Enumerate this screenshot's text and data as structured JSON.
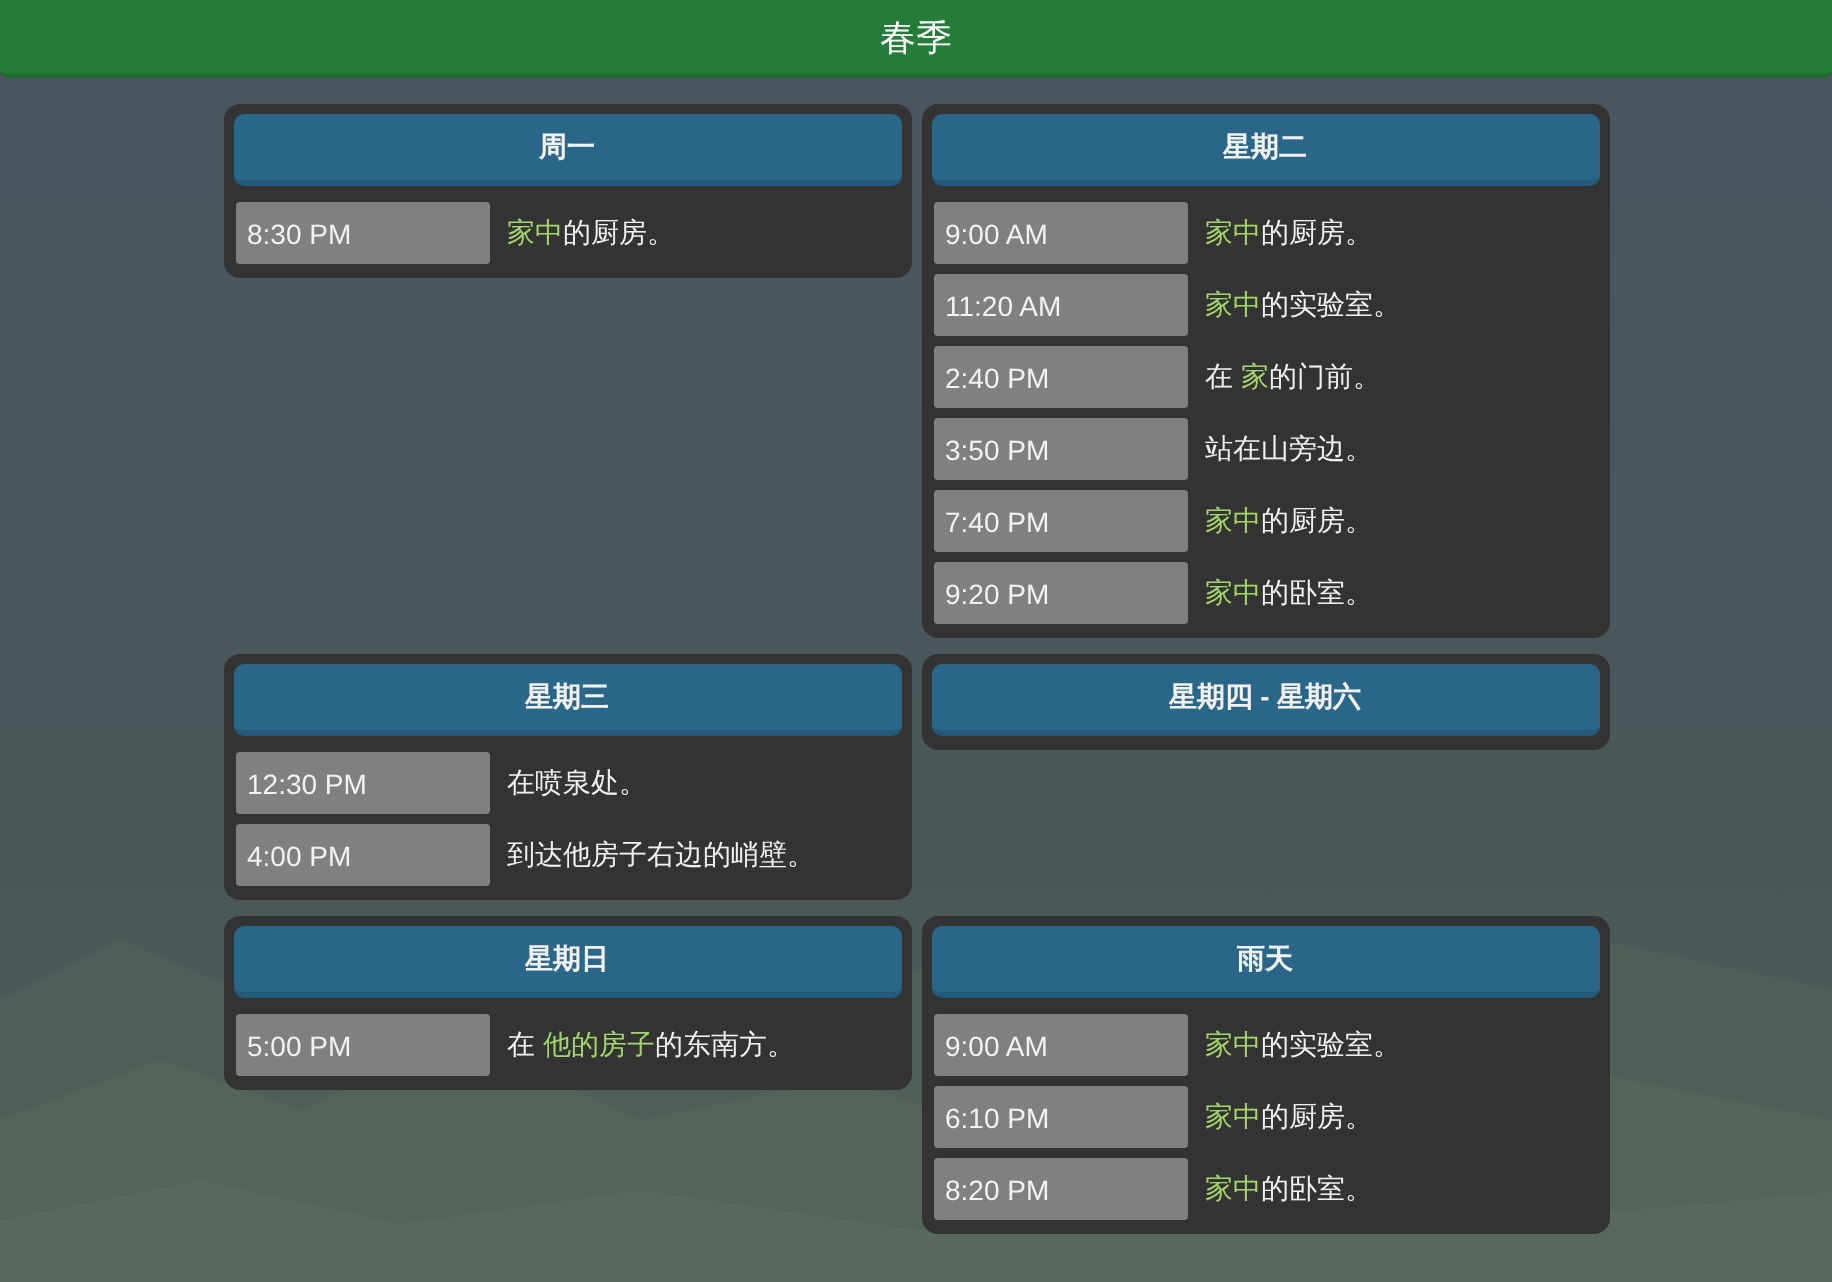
{
  "title": "春季",
  "days": [
    {
      "name": "周一",
      "entries": [
        {
          "time": "8:30 PM",
          "place": [
            {
              "text": "家中",
              "highlight": true
            },
            {
              "text": "的厨房。",
              "highlight": false
            }
          ]
        }
      ]
    },
    {
      "name": "星期二",
      "entries": [
        {
          "time": "9:00 AM",
          "place": [
            {
              "text": "家中",
              "highlight": true
            },
            {
              "text": "的厨房。",
              "highlight": false
            }
          ]
        },
        {
          "time": "11:20 AM",
          "place": [
            {
              "text": "家中",
              "highlight": true
            },
            {
              "text": "的实验室。",
              "highlight": false
            }
          ]
        },
        {
          "time": "2:40 PM",
          "place": [
            {
              "text": "在 ",
              "highlight": false
            },
            {
              "text": "家",
              "highlight": true
            },
            {
              "text": "的门前。",
              "highlight": false
            }
          ]
        },
        {
          "time": "3:50 PM",
          "place": [
            {
              "text": "站在山旁边。",
              "highlight": false
            }
          ]
        },
        {
          "time": "7:40 PM",
          "place": [
            {
              "text": "家中",
              "highlight": true
            },
            {
              "text": "的厨房。",
              "highlight": false
            }
          ]
        },
        {
          "time": "9:20 PM",
          "place": [
            {
              "text": "家中",
              "highlight": true
            },
            {
              "text": "的卧室。",
              "highlight": false
            }
          ]
        }
      ]
    },
    {
      "name": "星期三",
      "entries": [
        {
          "time": "12:30 PM",
          "place": [
            {
              "text": "在喷泉处。",
              "highlight": false
            }
          ]
        },
        {
          "time": "4:00 PM",
          "place": [
            {
              "text": "到达他房子右边的峭壁。",
              "highlight": false
            }
          ]
        }
      ]
    },
    {
      "name": "星期四 - 星期六"
    },
    {
      "name": "星期日",
      "entries": [
        {
          "time": "5:00 PM",
          "place": [
            {
              "text": "在 ",
              "highlight": false
            },
            {
              "text": "他的房子",
              "highlight": true
            },
            {
              "text": "的东南方。",
              "highlight": false
            }
          ]
        }
      ]
    },
    {
      "name": "雨天",
      "entries": [
        {
          "time": "9:00 AM",
          "place": [
            {
              "text": "家中",
              "highlight": true
            },
            {
              "text": "的实验室。",
              "highlight": false
            }
          ]
        },
        {
          "time": "6:10 PM",
          "place": [
            {
              "text": "家中",
              "highlight": true
            },
            {
              "text": "的厨房。",
              "highlight": false
            }
          ]
        },
        {
          "time": "8:20 PM",
          "place": [
            {
              "text": "家中",
              "highlight": true
            },
            {
              "text": "的卧室。",
              "highlight": false
            }
          ]
        }
      ]
    }
  ]
}
